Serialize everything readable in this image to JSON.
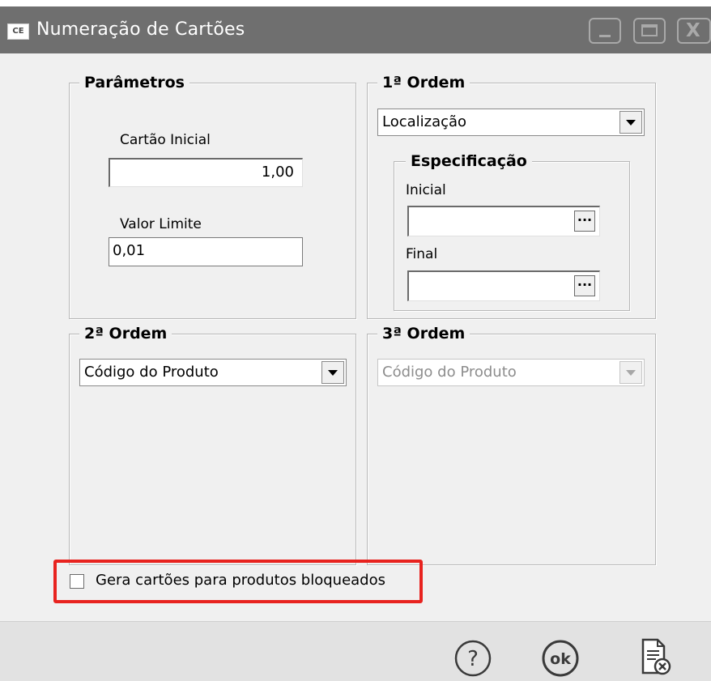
{
  "window": {
    "app_icon": "CE",
    "title": "Numeração de Cartões",
    "controls": [
      "minimize-icon",
      "maximize-icon",
      "close-icon"
    ],
    "close_glyph": "X"
  },
  "parametros": {
    "legend": "Parâmetros",
    "cartao_inicial_label": "Cartão Inicial",
    "cartao_inicial_value": "1,00",
    "valor_limite_label": "Valor Limite",
    "valor_limite_value": "0,01"
  },
  "ordem1": {
    "legend": "1ª Ordem",
    "selected": "Localização",
    "especificacao": {
      "legend": "Especificação",
      "inicial_label": "Inicial",
      "inicial_value": "",
      "final_label": "Final",
      "final_value": "",
      "lookup_glyph": "..."
    }
  },
  "ordem2": {
    "legend": "2ª Ordem",
    "selected": "Código do Produto"
  },
  "ordem3": {
    "legend": "3ª Ordem",
    "selected": "Código do Produto",
    "disabled": true
  },
  "checkbox": {
    "label": "Gera cartões para produtos bloqueados",
    "checked": false,
    "highlight_color": "#e8231f"
  },
  "footer": {
    "help_icon": "help-circle-icon",
    "ok_icon": "ok-circle-icon",
    "ok_text": "ok",
    "cancel_icon": "document-cancel-icon"
  },
  "colors": {
    "titlebar": "#6f6f6f",
    "background": "#f0f0f0"
  }
}
